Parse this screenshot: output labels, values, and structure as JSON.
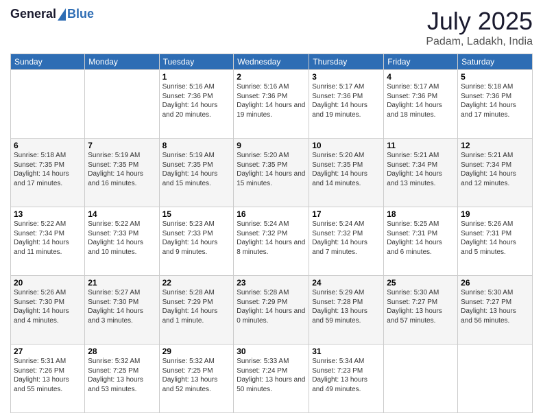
{
  "header": {
    "logo_general": "General",
    "logo_blue": "Blue",
    "title": "July 2025",
    "location": "Padam, Ladakh, India"
  },
  "weekdays": [
    "Sunday",
    "Monday",
    "Tuesday",
    "Wednesday",
    "Thursday",
    "Friday",
    "Saturday"
  ],
  "weeks": [
    [
      {
        "day": "",
        "info": ""
      },
      {
        "day": "",
        "info": ""
      },
      {
        "day": "1",
        "info": "Sunrise: 5:16 AM\nSunset: 7:36 PM\nDaylight: 14 hours and 20 minutes."
      },
      {
        "day": "2",
        "info": "Sunrise: 5:16 AM\nSunset: 7:36 PM\nDaylight: 14 hours and 19 minutes."
      },
      {
        "day": "3",
        "info": "Sunrise: 5:17 AM\nSunset: 7:36 PM\nDaylight: 14 hours and 19 minutes."
      },
      {
        "day": "4",
        "info": "Sunrise: 5:17 AM\nSunset: 7:36 PM\nDaylight: 14 hours and 18 minutes."
      },
      {
        "day": "5",
        "info": "Sunrise: 5:18 AM\nSunset: 7:36 PM\nDaylight: 14 hours and 17 minutes."
      }
    ],
    [
      {
        "day": "6",
        "info": "Sunrise: 5:18 AM\nSunset: 7:35 PM\nDaylight: 14 hours and 17 minutes."
      },
      {
        "day": "7",
        "info": "Sunrise: 5:19 AM\nSunset: 7:35 PM\nDaylight: 14 hours and 16 minutes."
      },
      {
        "day": "8",
        "info": "Sunrise: 5:19 AM\nSunset: 7:35 PM\nDaylight: 14 hours and 15 minutes."
      },
      {
        "day": "9",
        "info": "Sunrise: 5:20 AM\nSunset: 7:35 PM\nDaylight: 14 hours and 15 minutes."
      },
      {
        "day": "10",
        "info": "Sunrise: 5:20 AM\nSunset: 7:35 PM\nDaylight: 14 hours and 14 minutes."
      },
      {
        "day": "11",
        "info": "Sunrise: 5:21 AM\nSunset: 7:34 PM\nDaylight: 14 hours and 13 minutes."
      },
      {
        "day": "12",
        "info": "Sunrise: 5:21 AM\nSunset: 7:34 PM\nDaylight: 14 hours and 12 minutes."
      }
    ],
    [
      {
        "day": "13",
        "info": "Sunrise: 5:22 AM\nSunset: 7:34 PM\nDaylight: 14 hours and 11 minutes."
      },
      {
        "day": "14",
        "info": "Sunrise: 5:22 AM\nSunset: 7:33 PM\nDaylight: 14 hours and 10 minutes."
      },
      {
        "day": "15",
        "info": "Sunrise: 5:23 AM\nSunset: 7:33 PM\nDaylight: 14 hours and 9 minutes."
      },
      {
        "day": "16",
        "info": "Sunrise: 5:24 AM\nSunset: 7:32 PM\nDaylight: 14 hours and 8 minutes."
      },
      {
        "day": "17",
        "info": "Sunrise: 5:24 AM\nSunset: 7:32 PM\nDaylight: 14 hours and 7 minutes."
      },
      {
        "day": "18",
        "info": "Sunrise: 5:25 AM\nSunset: 7:31 PM\nDaylight: 14 hours and 6 minutes."
      },
      {
        "day": "19",
        "info": "Sunrise: 5:26 AM\nSunset: 7:31 PM\nDaylight: 14 hours and 5 minutes."
      }
    ],
    [
      {
        "day": "20",
        "info": "Sunrise: 5:26 AM\nSunset: 7:30 PM\nDaylight: 14 hours and 4 minutes."
      },
      {
        "day": "21",
        "info": "Sunrise: 5:27 AM\nSunset: 7:30 PM\nDaylight: 14 hours and 3 minutes."
      },
      {
        "day": "22",
        "info": "Sunrise: 5:28 AM\nSunset: 7:29 PM\nDaylight: 14 hours and 1 minute."
      },
      {
        "day": "23",
        "info": "Sunrise: 5:28 AM\nSunset: 7:29 PM\nDaylight: 14 hours and 0 minutes."
      },
      {
        "day": "24",
        "info": "Sunrise: 5:29 AM\nSunset: 7:28 PM\nDaylight: 13 hours and 59 minutes."
      },
      {
        "day": "25",
        "info": "Sunrise: 5:30 AM\nSunset: 7:27 PM\nDaylight: 13 hours and 57 minutes."
      },
      {
        "day": "26",
        "info": "Sunrise: 5:30 AM\nSunset: 7:27 PM\nDaylight: 13 hours and 56 minutes."
      }
    ],
    [
      {
        "day": "27",
        "info": "Sunrise: 5:31 AM\nSunset: 7:26 PM\nDaylight: 13 hours and 55 minutes."
      },
      {
        "day": "28",
        "info": "Sunrise: 5:32 AM\nSunset: 7:25 PM\nDaylight: 13 hours and 53 minutes."
      },
      {
        "day": "29",
        "info": "Sunrise: 5:32 AM\nSunset: 7:25 PM\nDaylight: 13 hours and 52 minutes."
      },
      {
        "day": "30",
        "info": "Sunrise: 5:33 AM\nSunset: 7:24 PM\nDaylight: 13 hours and 50 minutes."
      },
      {
        "day": "31",
        "info": "Sunrise: 5:34 AM\nSunset: 7:23 PM\nDaylight: 13 hours and 49 minutes."
      },
      {
        "day": "",
        "info": ""
      },
      {
        "day": "",
        "info": ""
      }
    ]
  ]
}
